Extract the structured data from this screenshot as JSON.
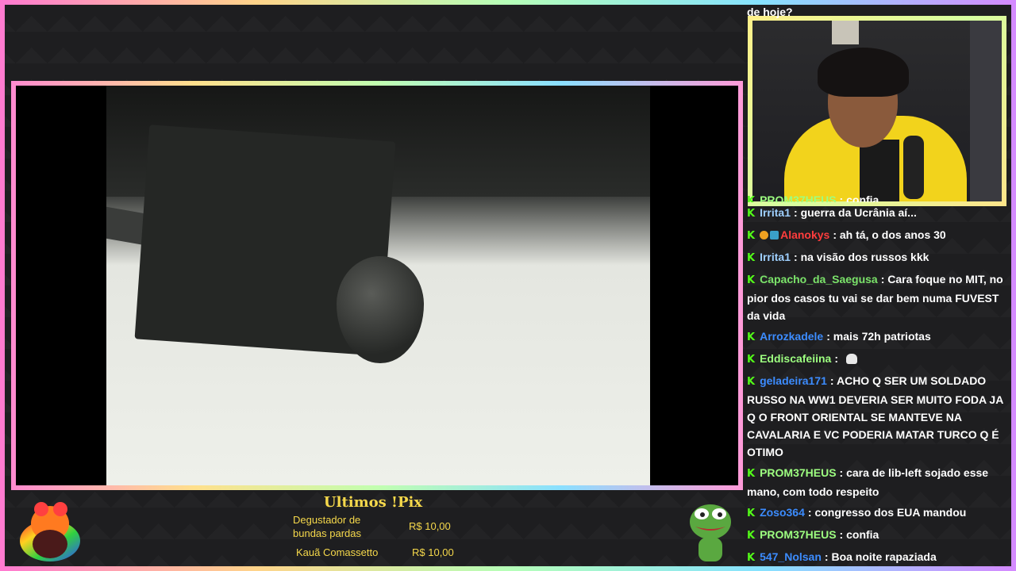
{
  "chat": {
    "top_clip": "de hoje?",
    "messages": [
      {
        "user": "PROM37HEUS",
        "user_color": "#9dff80",
        "text": "confia",
        "badges": []
      },
      {
        "user": "Irrita1",
        "user_color": "#9fd0ff",
        "text": "guerra da Ucrânia aí...",
        "badges": []
      },
      {
        "user": "Alanokys",
        "user_color": "#ff3d3d",
        "text": "ah tá, o dos anos 30",
        "badges": [
          "orange",
          "blue"
        ]
      },
      {
        "user": "Irrita1",
        "user_color": "#9fd0ff",
        "text": "na visão dos russos kkk",
        "badges": []
      },
      {
        "user": "Capacho_da_Saegusa",
        "user_color": "#7be36a",
        "text": "Cara foque no MIT, no pior dos casos tu vai se dar bem numa FUVEST da vida",
        "badges": []
      },
      {
        "user": "Arrozkadele",
        "user_color": "#3c8cff",
        "text": "mais 72h patriotas",
        "badges": []
      },
      {
        "user": "Eddiscafeiina",
        "user_color": "#9dff80",
        "text": "",
        "badges": [],
        "emote": "skull-icon"
      },
      {
        "user": "geladeira171",
        "user_color": "#3c8cff",
        "text": "ACHO Q SER UM SOLDADO RUSSO NA WW1 DEVERIA SER MUITO FODA JA Q O FRONT ORIENTAL SE MANTEVE NA CAVALARIA E VC PODERIA MATAR TURCO Q É OTIMO",
        "badges": []
      },
      {
        "user": "PROM37HEUS",
        "user_color": "#9dff80",
        "text": "cara de lib-left sojado esse mano, com todo respeito",
        "badges": []
      },
      {
        "user": "Zoso364",
        "user_color": "#3c8cff",
        "text": "congresso dos EUA mandou",
        "badges": []
      },
      {
        "user": "PROM37HEUS",
        "user_color": "#9dff80",
        "text": "confia",
        "badges": []
      },
      {
        "user": "547_Nolsan",
        "user_color": "#3c8cff",
        "text": "Boa noite rapaziada",
        "badges": []
      }
    ]
  },
  "pix": {
    "title": "Ultimos !Pix",
    "entries": [
      {
        "name": "Degustador de bundas pardas",
        "value": "R$ 10,00"
      },
      {
        "name": "Kauã Comassetto",
        "value": "R$ 10,00"
      }
    ]
  },
  "colors": {
    "pix_yellow": "#f5d84b",
    "kick_green": "#53fc18"
  }
}
